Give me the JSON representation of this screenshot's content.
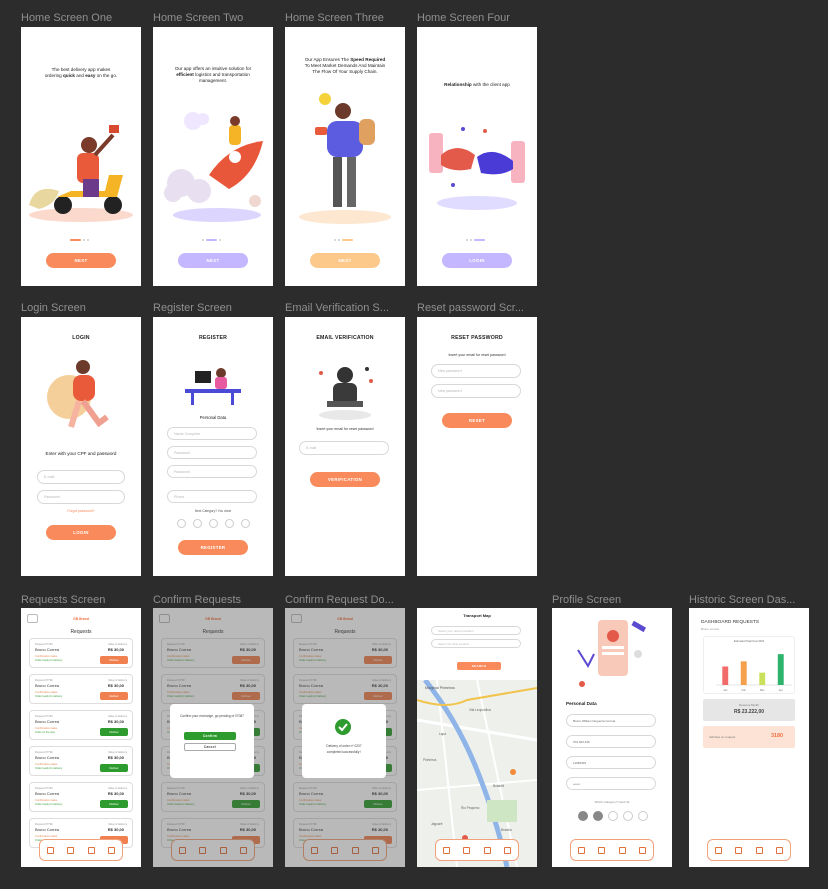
{
  "colors": {
    "orange": "#f98a5b",
    "lavender": "#c4b7ff",
    "yellow": "#fcc98a",
    "green": "#2d9b2d"
  },
  "labels": {
    "home1": "Home Screen One",
    "home2": "Home Screen Two",
    "home3": "Home Screen Three",
    "home4": "Home Screen Four",
    "login": "Login Screen",
    "register": "Register Screen",
    "email": "Email Verification S...",
    "reset": "Reset password Scr...",
    "requests": "Requests Screen",
    "confirm": "Confirm Requests",
    "confirmdone": "Confirm Request Do...",
    "profile": "Profile Screen",
    "historic": "Historic Screen Das..."
  },
  "home1": {
    "text_a": "The best delivery app makes",
    "text_b_pre": "ordering ",
    "text_b_q": "quick",
    "text_b_mid": " and ",
    "text_b_e": "easy",
    "text_b_post": " on the go.",
    "button": "NEXT"
  },
  "home2": {
    "text_a": "Our app offers an intuitive solution for",
    "text_b_e": "efficient",
    "text_b_post": " logistics and transportation",
    "text_c": "management.",
    "button": "NEXT"
  },
  "home3": {
    "text_a": "Our App Ensures The ",
    "text_a_b": "Speed Required",
    "text_b": "To Meet Market Demands And Maintain",
    "text_c": "The Flow Of Your Supply Chain.",
    "button": "NEXT"
  },
  "home4": {
    "text_b": "Relationship",
    "text_rest": " with the client app",
    "button": "LOGIN"
  },
  "login": {
    "title": "LOGIN",
    "prompt": "Enter with your CPF and password",
    "field1": "E-mail",
    "field2": "Password",
    "forgot": "Forgot password?",
    "button": "LOGIN"
  },
  "register": {
    "title": "REGISTER",
    "subtitle": "Personal Data",
    "field1": "Name Complete",
    "field2": "Password",
    "field3": "Password",
    "field4": "Phone",
    "category": "Next Category? You done",
    "button": "REGISTER"
  },
  "email": {
    "title": "EMAIL VERIFICATION",
    "prompt": "Insert your email for reset password",
    "field1": "E-mail",
    "button": "VERIFICATION"
  },
  "reset": {
    "title": "RESET PASSWORD",
    "prompt": "Insert your email for reset password",
    "field1": "New password",
    "field2": "New password",
    "button": "RESET"
  },
  "requests": {
    "brand": "GB Brand",
    "heading": "Requests",
    "cards": [
      {
        "label": "Request 07799",
        "name": "Bruno Correa",
        "status": "Confirmation status",
        "status2": "Order ready for delivery",
        "price_label": "Value of delivery",
        "price": "R$ 30,00",
        "btn": "Deliver",
        "btn_color": "#f08050"
      },
      {
        "label": "Request 07799",
        "name": "Bruno Correa",
        "status": "Confirmation status",
        "status2": "Order ready for delivery",
        "price_label": "Value of delivery",
        "price": "R$ 30,00",
        "btn": "Deliver",
        "btn_color": "#f08050"
      },
      {
        "label": "Request 07799",
        "name": "Bruno Correa",
        "status": "Confirmation status",
        "status2": "Order on the way",
        "price_label": "Value of delivery",
        "price": "R$ 30,00",
        "btn": "Deliver",
        "btn_color": "#2d9b2d"
      },
      {
        "label": "Request 07799",
        "name": "Bruno Correa",
        "status": "Confirmation status",
        "status2": "Order ready for delivery",
        "price_label": "Value of delivery",
        "price": "R$ 30,00",
        "btn": "Deliver",
        "btn_color": "#2d9b2d"
      },
      {
        "label": "Request 07799",
        "name": "Bruno Correa",
        "status": "Confirmation status",
        "status2": "Order ready for delivery",
        "price_label": "Value of delivery",
        "price": "R$ 30,00",
        "btn": "Deliver",
        "btn_color": "#2d9b2d"
      },
      {
        "label": "Request 07799",
        "name": "Bruno Correa",
        "status": "Confirmation status",
        "status2": "Order ready for delivery",
        "price_label": "Value of delivery",
        "price": "R$ 30,00",
        "btn": "Deliver",
        "btn_color": "#f08050"
      }
    ]
  },
  "confirm": {
    "question": "Confirm your exchange, go pending of 07087",
    "confirm": "Confirm",
    "cancel": "Cancel"
  },
  "confirmdone": {
    "msg1": "Delivery of order nº 0237",
    "msg2": "completed successfully !"
  },
  "map": {
    "title": "Transport Map",
    "field1": "Select your pickup location",
    "field2": "Select the drop location",
    "button": "SEARCH",
    "places": [
      "Marginal Pinheiros",
      "Vila Leopoldina",
      "Lapa",
      "Pinheiros",
      "Butantã",
      "Rio Pequeno",
      "Jaguaré",
      "Brasília"
    ]
  },
  "profile": {
    "title": "Personal Data",
    "field1": "Bruno William Nogueira Correia",
    "field2": "079.023.425",
    "field3": "11982345",
    "field4": "•••••••",
    "category": "Which Category? Card Ok"
  },
  "historic": {
    "title": "DASHBOARD REQUESTS",
    "subtitle": "Bruno correia",
    "chart_title": "Estimated Total Cost 2023",
    "total_label": "Revenue Month",
    "total": "R$ 23.222,00",
    "orders_label": "Vehicles on request",
    "orders": "3180"
  },
  "chart_data": {
    "type": "bar",
    "categories": [
      "Jan",
      "Feb",
      "Mar",
      "Apr"
    ],
    "values": [
      18,
      23,
      12,
      30
    ],
    "ylim": [
      0,
      35
    ],
    "series_colors": [
      "#f26b6b",
      "#f5a04a",
      "#c8e05a",
      "#2db36b"
    ]
  }
}
